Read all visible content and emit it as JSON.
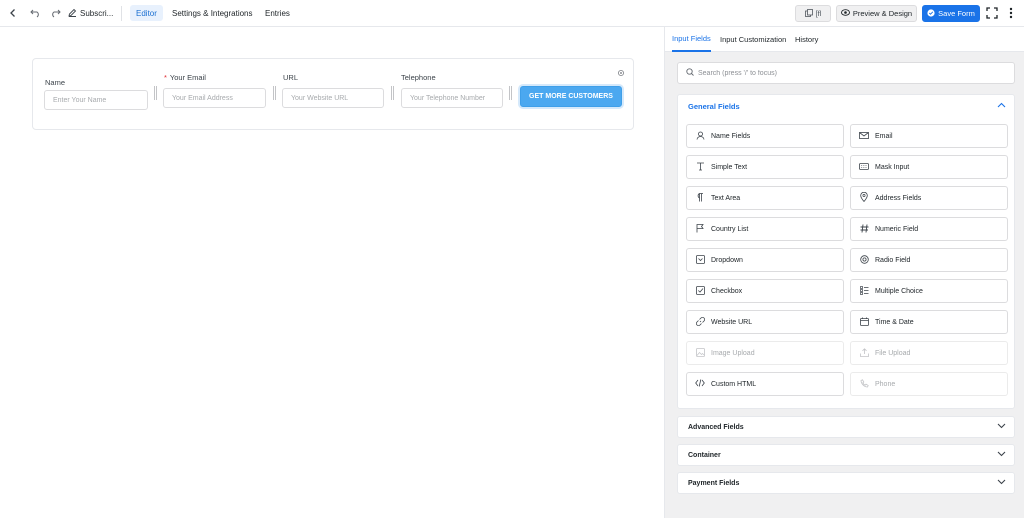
{
  "topbar": {
    "form_title": "Subscri...",
    "tabs": [
      {
        "label": "Editor",
        "active": true
      },
      {
        "label": "Settings & Integrations",
        "active": false
      },
      {
        "label": "Entries",
        "active": false
      }
    ],
    "shortcode_label": "[fl",
    "preview_label": "Preview & Design",
    "save_label": "Save Form"
  },
  "form": {
    "fields": [
      {
        "label": "Name",
        "required": false,
        "placeholder": "Enter Your Name"
      },
      {
        "label": "Your Email",
        "required": true,
        "placeholder": "Your Email Address"
      },
      {
        "label": "URL",
        "required": false,
        "placeholder": "Your Website URL"
      },
      {
        "label": "Telephone",
        "required": false,
        "placeholder": "Your Telephone Number"
      }
    ],
    "submit_label": "GET MORE CUSTOMERS"
  },
  "sidebar": {
    "tabs": [
      {
        "label": "Input Fields",
        "active": true
      },
      {
        "label": "Input Customization",
        "active": false
      },
      {
        "label": "History",
        "active": false
      }
    ],
    "search_placeholder": "Search (press '/' to focus)",
    "general": {
      "title": "General Fields",
      "items": [
        {
          "label": "Name Fields",
          "icon": "user-icon",
          "disabled": false
        },
        {
          "label": "Email",
          "icon": "email-icon",
          "disabled": false
        },
        {
          "label": "Simple Text",
          "icon": "text-icon",
          "disabled": false
        },
        {
          "label": "Mask Input",
          "icon": "keyboard-icon",
          "disabled": false
        },
        {
          "label": "Text Area",
          "icon": "paragraph-icon",
          "disabled": false
        },
        {
          "label": "Address Fields",
          "icon": "location-pin-icon",
          "disabled": false
        },
        {
          "label": "Country List",
          "icon": "flag-icon",
          "disabled": false
        },
        {
          "label": "Numeric Field",
          "icon": "hash-icon",
          "disabled": false
        },
        {
          "label": "Dropdown",
          "icon": "dropdown-icon",
          "disabled": false
        },
        {
          "label": "Radio Field",
          "icon": "radio-icon",
          "disabled": false
        },
        {
          "label": "Checkbox",
          "icon": "checkbox-icon",
          "disabled": false
        },
        {
          "label": "Multiple Choice",
          "icon": "list-icon",
          "disabled": false
        },
        {
          "label": "Website URL",
          "icon": "link-icon",
          "disabled": false
        },
        {
          "label": "Time & Date",
          "icon": "calendar-icon",
          "disabled": false
        },
        {
          "label": "Image Upload",
          "icon": "image-icon",
          "disabled": true
        },
        {
          "label": "File Upload",
          "icon": "upload-icon",
          "disabled": true
        },
        {
          "label": "Custom HTML",
          "icon": "code-icon",
          "disabled": false
        },
        {
          "label": "Phone",
          "icon": "phone-icon",
          "disabled": true
        }
      ]
    },
    "panels": [
      {
        "title": "Advanced Fields"
      },
      {
        "title": "Container"
      },
      {
        "title": "Payment Fields"
      }
    ]
  },
  "colors": {
    "accent": "#1a73e8",
    "submit": "#4ba8f0",
    "required": "#e0282e"
  }
}
